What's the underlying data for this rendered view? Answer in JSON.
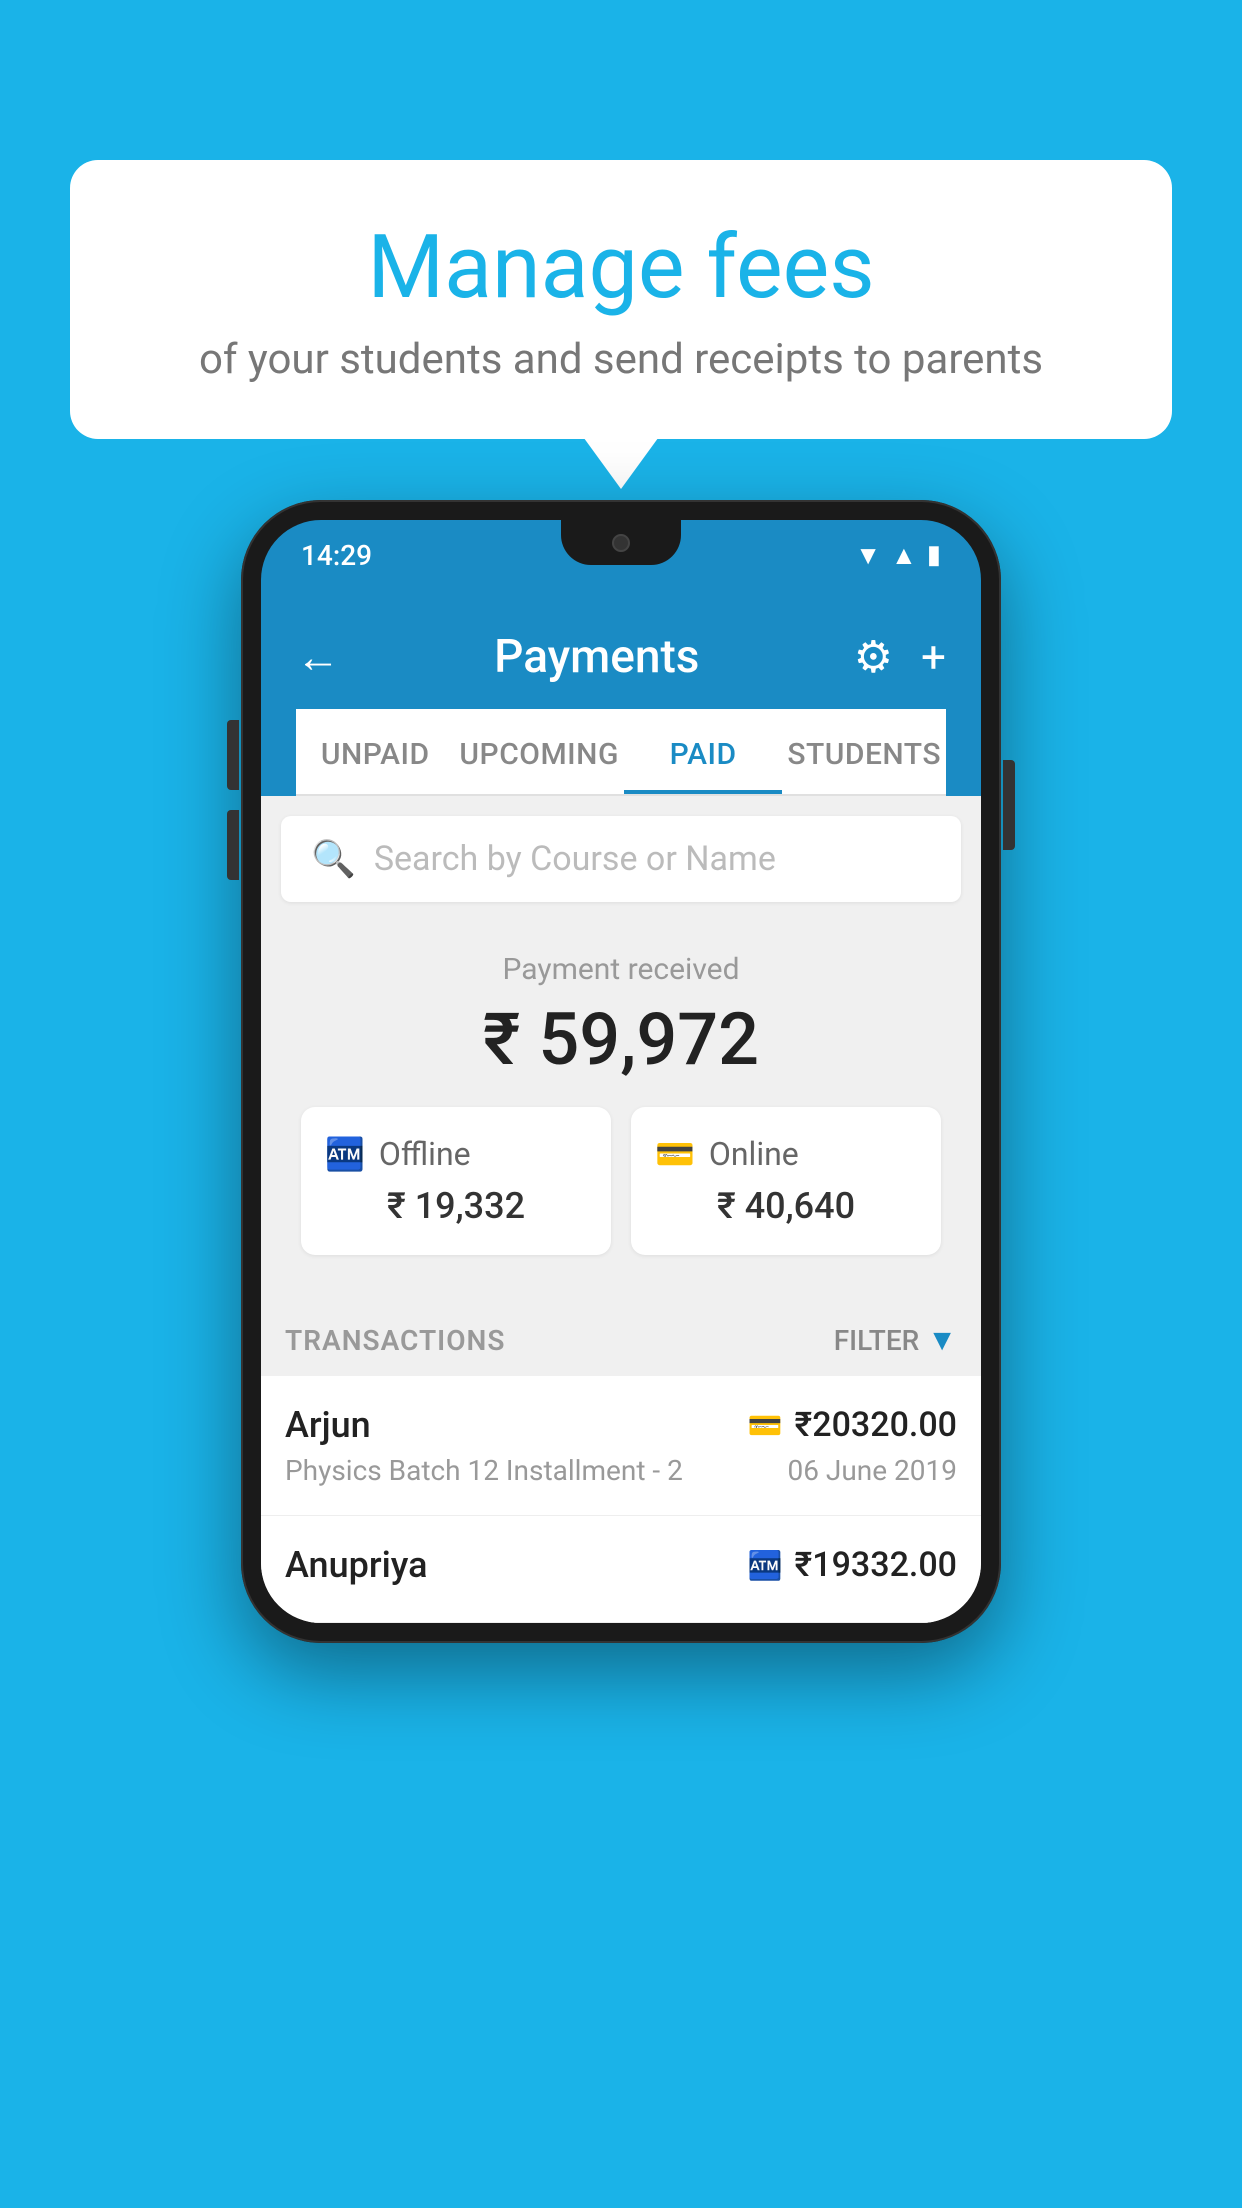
{
  "background_color": "#1ab3e8",
  "speech_bubble": {
    "title": "Manage fees",
    "subtitle": "of your students and send receipts to parents"
  },
  "phone": {
    "status_bar": {
      "time": "14:29"
    },
    "header": {
      "back_label": "←",
      "title": "Payments",
      "gear_icon": "⚙",
      "plus_icon": "+"
    },
    "tabs": [
      {
        "label": "UNPAID",
        "active": false
      },
      {
        "label": "UPCOMING",
        "active": false
      },
      {
        "label": "PAID",
        "active": true
      },
      {
        "label": "STUDENTS",
        "active": false
      }
    ],
    "search": {
      "placeholder": "Search by Course or Name"
    },
    "payment_summary": {
      "label": "Payment received",
      "amount": "₹ 59,972"
    },
    "payment_cards": [
      {
        "type": "Offline",
        "amount": "₹ 19,332",
        "icon": "🏧"
      },
      {
        "type": "Online",
        "amount": "₹ 40,640",
        "icon": "💳"
      }
    ],
    "transactions_header": {
      "label": "TRANSACTIONS",
      "filter_label": "FILTER"
    },
    "transactions": [
      {
        "name": "Arjun",
        "amount": "₹20320.00",
        "description": "Physics Batch 12 Installment - 2",
        "date": "06 June 2019",
        "payment_type": "online"
      },
      {
        "name": "Anupriya",
        "amount": "₹19332.00",
        "description": "",
        "date": "",
        "payment_type": "offline"
      }
    ]
  }
}
